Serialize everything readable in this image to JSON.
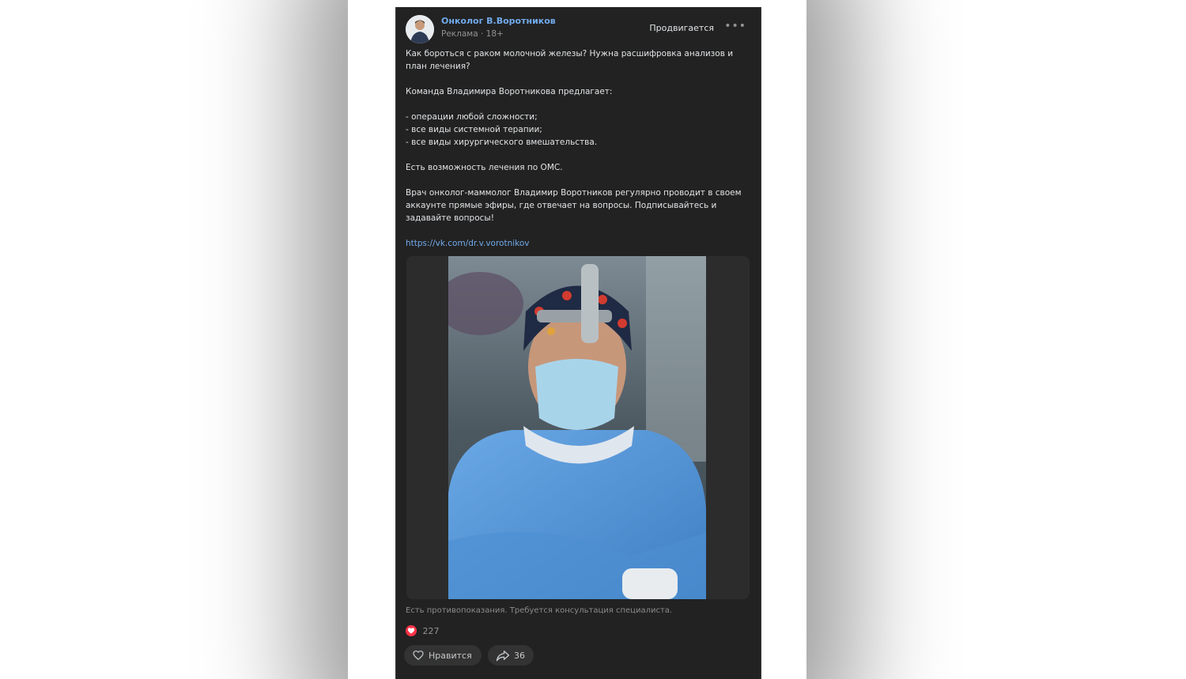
{
  "post": {
    "author": "Онколог В.Воротников",
    "ad_label": "Реклама",
    "age_label": "18+",
    "promoted": "Продвигается",
    "more_icon": "more-horizontal-icon",
    "paragraphs": [
      "Как бороться с раком молочной железы? Нужна расшифровка анализов и план лечения?",
      "Команда Владимира Воротникова предлагает:",
      "- операции любой сложности;\n- все виды системной терапии;\n- все виды хирургического вмешательства.",
      "Есть возможность лечения по ОМС.",
      "Врач онколог-маммолог Владимир Воротников регулярно проводит в своем аккаунте прямые эфиры, где отвечает на вопросы. Подписывайтесь и задавайте вопросы!"
    ],
    "link": "https://vk.com/dr.v.vorotnikov",
    "disclaimer": "Есть противопоказания. Требуется консультация специалиста.",
    "reactions_count": "227",
    "like_label": "Нравится",
    "share_count": "36"
  },
  "colors": {
    "card_bg": "#222222",
    "link": "#71aaeb",
    "reaction_red": "#ff3347",
    "scrubs_blue": "#5b9ad8"
  }
}
